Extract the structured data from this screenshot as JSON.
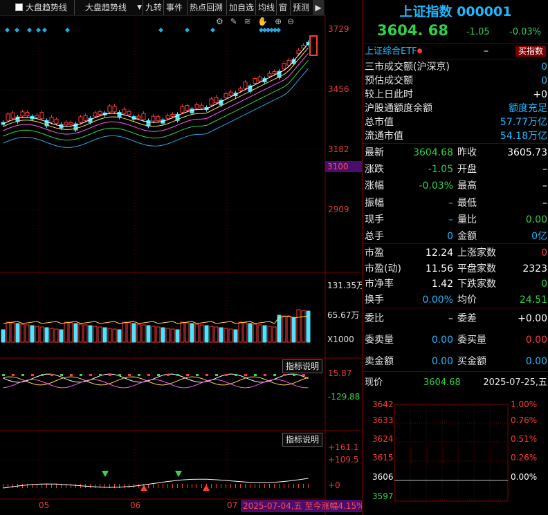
{
  "toolbar": {
    "checkbox_label": "大盘趋势线",
    "dropdown_value": "大盘趋势线",
    "buttons": [
      "九转",
      "事件",
      "热点回溯",
      "加自选",
      "均线",
      "窗",
      "预测"
    ],
    "collapse_icon": "panel-collapse-icon"
  },
  "chart": {
    "price_axis": [
      "3729",
      "3456",
      "3182",
      "3100",
      "2909"
    ],
    "volume_axis": [
      "131.35万",
      "65.67万",
      "X1000"
    ],
    "indicator1": {
      "button": "指标说明",
      "values": [
        "15.87",
        "-129.88"
      ]
    },
    "indicator2": {
      "button": "指标说明",
      "values": [
        "+161.1",
        "+109.5",
        "+0"
      ]
    },
    "months": [
      "05",
      "06",
      "07"
    ],
    "range_badge": "2025-07-04,五 至今涨幅4.15%",
    "tool_icons": [
      "gear-icon",
      "pen-icon",
      "layers-icon",
      "hand-icon",
      "zoom-in-icon",
      "zoom-out-icon"
    ]
  },
  "panel": {
    "title": "上证指数 000001",
    "price": "3604. 68",
    "change": "-1.05",
    "change_pct": "-0.03%",
    "etf": {
      "label": "上证综合ETF",
      "dash": "–",
      "buy_button": "买指数"
    },
    "info": [
      {
        "label": "三市成交额(沪深京)",
        "value": "0"
      },
      {
        "label": "预估成交额",
        "value": "0"
      },
      {
        "label": "较上日此时",
        "value": "+0"
      },
      {
        "label": "沪股通额度余额",
        "value": "额度充足"
      },
      {
        "label": "总市值",
        "value": "57.77万亿"
      },
      {
        "label": "流通市值",
        "value": "54.18万亿"
      }
    ],
    "quote": [
      {
        "l1": "最新",
        "v1": "3604.68",
        "l2": "昨收",
        "v2": "3605.73"
      },
      {
        "l1": "涨跌",
        "v1": "-1.05",
        "l2": "开盘",
        "v2": "–"
      },
      {
        "l1": "涨幅",
        "v1": "-0.03%",
        "l2": "最高",
        "v2": "–"
      },
      {
        "l1": "振幅",
        "v1": "–",
        "l2": "最低",
        "v2": "–"
      },
      {
        "l1": "现手",
        "v1": "–",
        "l2": "量比",
        "v2": "0.00"
      },
      {
        "l1": "总手",
        "v1": "0",
        "l2": "金额",
        "v2": "0亿"
      }
    ],
    "stats": [
      {
        "l1": "市盈",
        "v1": "12.24",
        "l2": "上涨家数",
        "v2": "0"
      },
      {
        "l1": "市盈(动)",
        "v1": "11.56",
        "l2": "平盘家数",
        "v2": "2323"
      },
      {
        "l1": "市净率",
        "v1": "1.42",
        "l2": "下跌家数",
        "v2": "0"
      },
      {
        "l1": "换手",
        "v1": "0.00%",
        "l2": "均价",
        "v2": "24.51"
      }
    ],
    "order": [
      {
        "l1": "委比",
        "v1": "–",
        "l2": "委差",
        "v2": "+0.00"
      },
      {
        "l1": "委卖量",
        "v1": "0.00",
        "l2": "委买量",
        "v2": "0.00"
      },
      {
        "l1": "卖金额",
        "v1": "0.00",
        "l2": "买金额",
        "v2": "0.00"
      }
    ],
    "now": {
      "label": "现价",
      "price": "3604.68",
      "date": "2025-07-25,五"
    },
    "intraday_axis_left": [
      "3642",
      "3633",
      "3624",
      "3615",
      "3606",
      "3597"
    ],
    "intraday_axis_right": [
      "1.00%",
      "0.76%",
      "0.51%",
      "0.26%",
      "0.00%"
    ]
  },
  "colors": {
    "up": "#ff3b3b",
    "down": "#2fd24a",
    "cyan": "#1fb8ff",
    "bg": "#000000"
  }
}
